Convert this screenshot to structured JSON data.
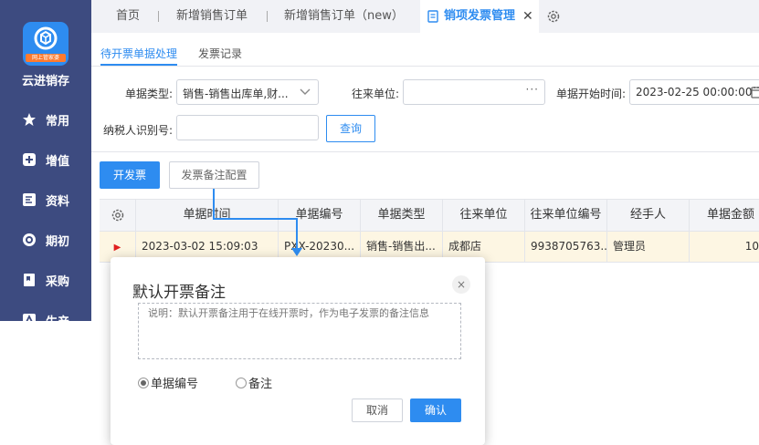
{
  "app": {
    "name": "云进销存",
    "badge": "网上管家婆"
  },
  "sidebar": {
    "items": [
      {
        "label": "常用",
        "icon": "star-icon"
      },
      {
        "label": "增值",
        "icon": "plus-square-icon"
      },
      {
        "label": "资料",
        "icon": "document-icon"
      },
      {
        "label": "期初",
        "icon": "target-icon"
      },
      {
        "label": "采购",
        "icon": "purchase-book-icon"
      },
      {
        "label": "生产",
        "icon": "production-icon"
      }
    ]
  },
  "tabs": [
    {
      "label": "首页"
    },
    {
      "label": "新增销售订单"
    },
    {
      "label": "新增销售订单（new）"
    },
    {
      "label": "销项发票管理",
      "active": true
    }
  ],
  "subtabs": [
    {
      "label": "待开票单据处理",
      "active": true
    },
    {
      "label": "发票记录"
    }
  ],
  "filters": {
    "doc_type_label": "单据类型:",
    "doc_type_value": "销售-销售出库单,财...",
    "partner_label": "往来单位:",
    "partner_value": "",
    "start_time_label": "单据开始时间:",
    "start_time_value": "2023-02-25 00:00:00",
    "taxpayer_label": "纳税人识别号:",
    "taxpayer_value": "",
    "query_button": "查询"
  },
  "actions": {
    "issue_invoice": "开发票",
    "remark_config": "发票备注配置"
  },
  "table": {
    "columns": [
      "单据时间",
      "单据编号",
      "单据类型",
      "往来单位",
      "往来单位编号",
      "经手人",
      "单据金额"
    ],
    "rows": [
      {
        "marker": "▶",
        "time": "2023-03-02 15:09:03",
        "number": "PXX-20230...",
        "type": "销售-销售出...",
        "partner": "成都店",
        "partner_no": "9938705763...",
        "handler": "管理员",
        "amount": "10"
      }
    ]
  },
  "dialog": {
    "title": "默认开票备注",
    "close": "×",
    "note": "说明：默认开票备注用于在线开票时，作为电子发票的备注信息",
    "options": [
      {
        "label": "单据编号",
        "checked": true
      },
      {
        "label": "备注",
        "checked": false
      }
    ],
    "cancel": "取消",
    "confirm": "确认"
  },
  "colors": {
    "sidebar_bg": "#3d4b80",
    "accent": "#2e8cf0",
    "row_highlight": "#fdf6e3",
    "logo_badge": "#ff7a2e"
  }
}
